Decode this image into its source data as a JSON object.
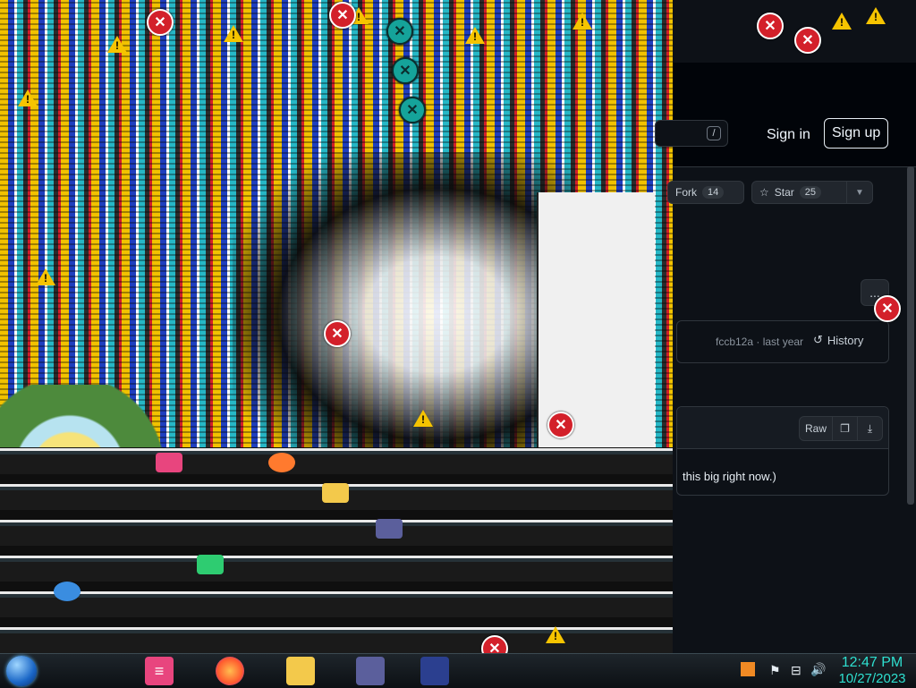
{
  "github": {
    "search_shortcut": "/",
    "sign_in": "Sign in",
    "sign_up": "Sign up",
    "fork_label": "Fork",
    "fork_count": "14",
    "star_label": "Star",
    "star_count": "25",
    "more_label": "...",
    "commit_hash": "fccb12a · last year",
    "history_label": "History",
    "raw_label": "Raw",
    "file_text": "this big right now.)"
  },
  "taskbar": {
    "time": "12:47 PM",
    "date": "10/27/2023"
  },
  "icons": {
    "warning": "warning-icon",
    "error": "error-icon",
    "start": "windows-start-icon",
    "firefox": "firefox-icon",
    "explorer": "file-explorer-icon"
  },
  "colors": {
    "github_bg": "#0d1117",
    "clock_color": "#2ee0d0",
    "error_red": "#d3202a",
    "warning_yellow": "#f6c400"
  }
}
